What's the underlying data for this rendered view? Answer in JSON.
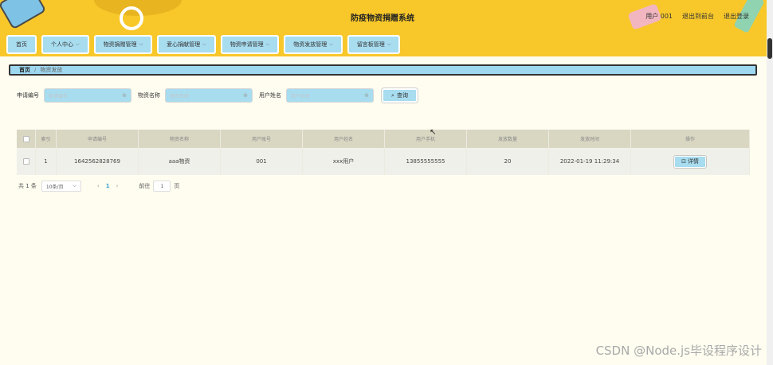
{
  "header": {
    "title": "防疫物资捐赠系统",
    "user_label": "用户 001",
    "back_label": "退出到前台",
    "logout_label": "退出登录"
  },
  "nav": [
    {
      "label": "首页",
      "dropdown": false
    },
    {
      "label": "个人中心",
      "dropdown": true
    },
    {
      "label": "物资捐赠管理",
      "dropdown": true
    },
    {
      "label": "爱心捐献管理",
      "dropdown": true
    },
    {
      "label": "物资申请管理",
      "dropdown": true
    },
    {
      "label": "物资发放管理",
      "dropdown": true
    },
    {
      "label": "留言板管理",
      "dropdown": true
    }
  ],
  "breadcrumb": {
    "home": "首页",
    "separator": "/",
    "current": "物资发放"
  },
  "search": {
    "fields": [
      {
        "label": "申请编号",
        "placeholder": "申请编号"
      },
      {
        "label": "物资名称",
        "placeholder": "物资名称"
      },
      {
        "label": "用户姓名",
        "placeholder": "用户姓名"
      }
    ],
    "button_label": "查询"
  },
  "table": {
    "columns": [
      "索引",
      "申请编号",
      "物资名称",
      "用户账号",
      "用户姓名",
      "用户手机",
      "发放数量",
      "发放时间",
      "操作"
    ],
    "rows": [
      [
        "1",
        "1642562828769",
        "aaa物资",
        "001",
        "xxx用户",
        "13855555555",
        "20",
        "2022-01-19 11:29:34"
      ]
    ],
    "action_label": "详情"
  },
  "pagination": {
    "total_text": "共 1 条",
    "page_size": "10条/页",
    "current_page": "1",
    "goto_label": "前往",
    "goto_value": "1",
    "page_suffix": "页"
  },
  "watermark": "CSDN @Node.js毕设程序设计",
  "colors": {
    "header": "#f8c82a",
    "accent": "#a8dcef",
    "background": "#fffdf0"
  }
}
